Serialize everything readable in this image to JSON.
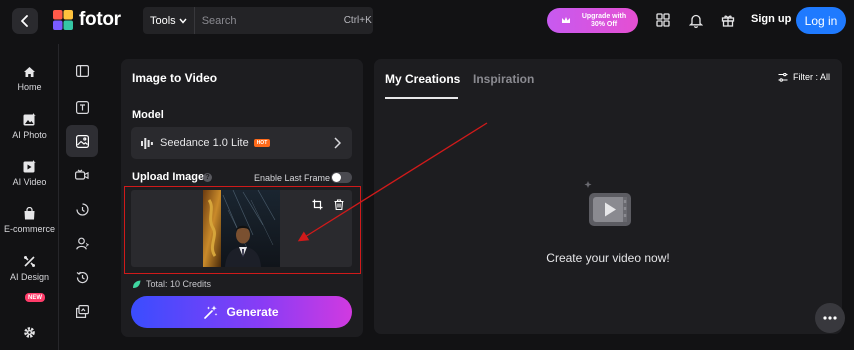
{
  "header": {
    "logo_text": "fotor",
    "tools_label": "Tools",
    "search_placeholder": "Search",
    "search_shortcut": "Ctrl+K",
    "upgrade_label": "Upgrade with 30% Off",
    "signup_label": "Sign up",
    "login_label": "Log in"
  },
  "sidebar": {
    "items": [
      {
        "label": "Home",
        "icon": "home-icon"
      },
      {
        "label": "AI Photo",
        "icon": "ai-photo-icon"
      },
      {
        "label": "AI Video",
        "icon": "ai-video-icon"
      },
      {
        "label": "E-commerce",
        "icon": "shopping-bag-icon"
      },
      {
        "label": "AI Design",
        "icon": "ai-design-icon",
        "badge": "NEW"
      }
    ],
    "settings_icon": "gear-icon"
  },
  "form": {
    "title": "Image to Video",
    "model_label": "Model",
    "model_name": "Seedance 1.0 Lite",
    "model_badge": "HOT",
    "upload_label": "Upload Image",
    "help_glyph": "?",
    "last_frame_label": "Enable Last Frame",
    "last_frame_enabled": false,
    "credits_text": "Total: 10 Credits",
    "generate_label": "Generate"
  },
  "creations": {
    "tabs": [
      "My Creations",
      "Inspiration"
    ],
    "active_tab": "My Creations",
    "filter_label": "Filter : All",
    "empty_text": "Create your video now!"
  },
  "colors": {
    "background": "#121214",
    "panel": "#1d1d20",
    "login_blue": "#1f7aff",
    "annotation_red": "#d01a1a",
    "upgrade_pink": "#e54fd2",
    "generate_start": "#3a4dff",
    "generate_end": "#d13ae0"
  }
}
